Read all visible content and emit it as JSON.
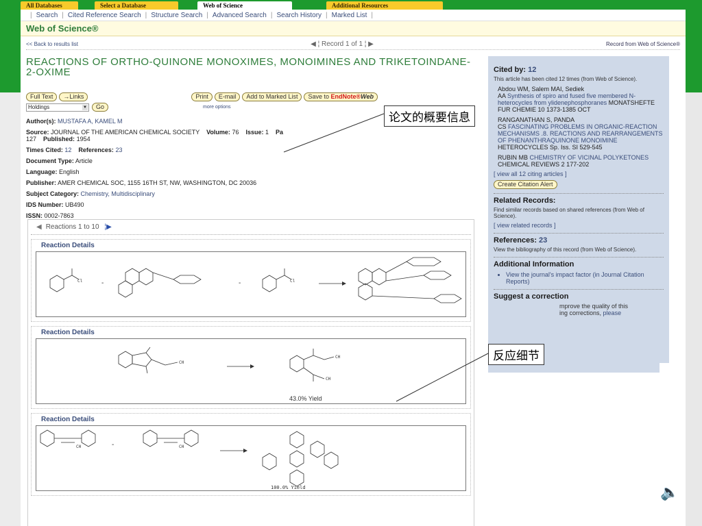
{
  "top_tabs": [
    "All Databases",
    "Select a Database",
    "Web of Science",
    "Additional Resources"
  ],
  "subnav": [
    "Search",
    "Cited Reference Search",
    "Structure Search",
    "Advanced Search",
    "Search History",
    "Marked List"
  ],
  "wos_title": "Web of Science®",
  "record_bar": {
    "back": "<< Back to results list",
    "record": "Record 1 of 1",
    "source": "Record from Web of Science®"
  },
  "article": {
    "title": "REACTIONS OF ORTHO-QUINONE MONOXIMES, MONOIMINES AND TRIKETOINDANE-2-OXIME",
    "buttons": {
      "full_text": "Full Text",
      "links": "→Links",
      "print": "Print",
      "email": "E-mail",
      "marked": "Add to Marked List",
      "save": "Save to",
      "endnote_a": "EndNote®",
      "endnote_b": "Web"
    },
    "holdings": "Holdings",
    "go": "Go",
    "more_options": "more options",
    "authors_label": "Author(s):",
    "authors": "MUSTAFA A, KAMEL M",
    "source_label": "Source:",
    "source": "JOURNAL OF THE AMERICAN CHEMICAL SOCIETY",
    "volume_label": "Volume:",
    "volume": "76",
    "issue_label": "Issue:",
    "issue": "1",
    "pages_label": "Pa",
    "pages_cont": "127",
    "published_label": "Published:",
    "published": "1954",
    "times_cited_label": "Times Cited:",
    "times_cited": "12",
    "references_label": "References:",
    "references": "23",
    "doctype_label": "Document Type:",
    "doctype": "Article",
    "language_label": "Language:",
    "language": "English",
    "publisher_label": "Publisher:",
    "publisher": "AMER CHEMICAL SOC, 1155 16TH ST, NW, WASHINGTON, DC 20036",
    "subject_label": "Subject Category:",
    "subject": "Chemistry, Multidisciplinary",
    "ids_label": "IDS Number:",
    "ids": "UB490",
    "issn_label": "ISSN:",
    "issn": "0002-7863"
  },
  "reactions": {
    "nav": "Reactions 1 to 10",
    "items": [
      {
        "heading": "Reaction Details",
        "yield": ""
      },
      {
        "heading": "Reaction Details",
        "yield": "43.0% Yield"
      },
      {
        "heading": "Reaction Details",
        "yield": "100.0% Yield"
      }
    ]
  },
  "sidebar": {
    "cited_by_label": "Cited by:",
    "cited_by": "12",
    "cited_note": "This article has been cited 12 times (from Web of Science).",
    "cites": [
      {
        "authors": "Abdou WM, Salem MAI, Sediek",
        "prefix": "AA",
        "title": "Synthesis of spiro and fused five membered N-heterocycles from ylidenephosphoranes",
        "source": "MONATSHEFTE FUR CHEMIE 10 1373-1385 OCT"
      },
      {
        "authors": "RANGANATHAN S, PANDA",
        "prefix": "CS",
        "title": "FASCINATING PROBLEMS IN ORGANIC-REACTION MECHANISMS .8. REACTIONS AND REARRANGEMENTS OF PHENANTHRAQUINONE MONOIMINE",
        "source": "HETEROCYCLES Sp. Iss. SI 529-545"
      },
      {
        "authors": "RUBIN MB",
        "prefix": "",
        "title": "CHEMISTRY OF VICINAL POLYKETONES",
        "source": "CHEMICAL REVIEWS 2 177-202"
      }
    ],
    "view_all": "view all 12 citing articles",
    "alert": "Create Citation Alert",
    "related_title": "Related Records:",
    "related_note": "Find similar records based on shared references (from Web of Science).",
    "related_link": "view related records",
    "refs_label": "References:",
    "refs": "23",
    "refs_note": "View the bibliography of this record (from Web of Science).",
    "addl_title": "Additional Information",
    "addl_item": "View the journal's impact factor (in Journal Citation Reports)",
    "suggest_title": "Suggest a correction",
    "suggest_text": "mprove the quality of this",
    "suggest_text2": "ing corrections,",
    "suggest_link": "please"
  },
  "callouts": {
    "summary": "论文的概要信息",
    "details": "反应细节"
  }
}
